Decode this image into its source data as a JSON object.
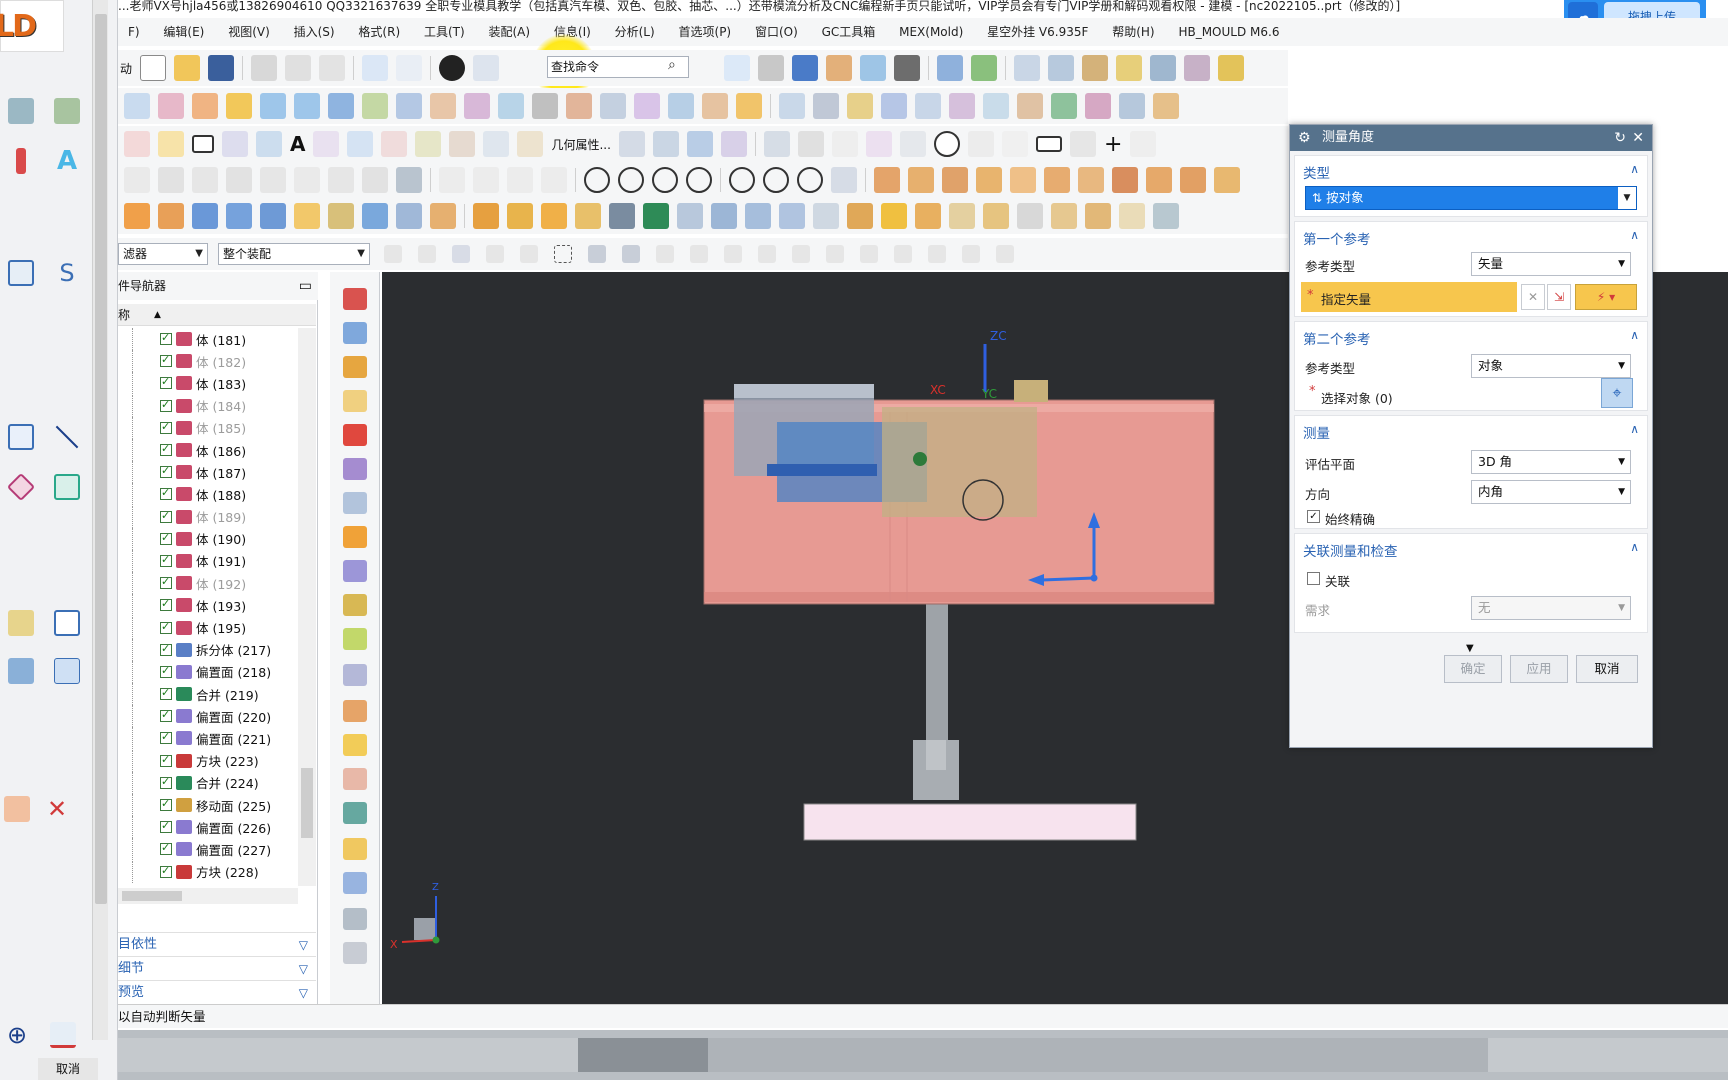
{
  "app": {
    "title_text": "...老师VX号hjla456或13826904610 QQ3321637639 全职专业模具教学（包括真汽车模、双色、包胶、抽芯、...）还带模流分析及CNC编程新手页只能试听，VIP学员会有专门VIP学册和解码观看权限 - 建模 - [nc2022105..prt（修改的）]",
    "logo_text": "LD",
    "cloud_upload_label": "拖拽上传"
  },
  "menu": {
    "items": [
      "F)",
      "编辑(E)",
      "视图(V)",
      "插入(S)",
      "格式(R)",
      "工具(T)",
      "装配(A)",
      "信息(I)",
      "分析(L)",
      "首选项(P)",
      "窗口(O)",
      "GC工具箱",
      "MEX(Mold)",
      "星空外挂 V6.935F",
      "帮助(H)",
      "HB_MOULD M6.6"
    ]
  },
  "toolbar": {
    "search_placeholder": "查找命令",
    "geometry_props_label": "几何属性...",
    "row1_left_label": "动"
  },
  "filter_row": {
    "type_filter": "滤器",
    "scope_filter": "整个装配"
  },
  "navigator": {
    "title": "件导航器",
    "column_header": "称",
    "rows": [
      {
        "label": "体 (181)",
        "dim": false,
        "icon": "body-icon"
      },
      {
        "label": "体 (182)",
        "dim": true,
        "icon": "body-icon"
      },
      {
        "label": "体 (183)",
        "dim": false,
        "icon": "body-icon"
      },
      {
        "label": "体 (184)",
        "dim": true,
        "icon": "body-icon"
      },
      {
        "label": "体 (185)",
        "dim": true,
        "icon": "body-icon"
      },
      {
        "label": "体 (186)",
        "dim": false,
        "icon": "body-icon"
      },
      {
        "label": "体 (187)",
        "dim": false,
        "icon": "body-icon"
      },
      {
        "label": "体 (188)",
        "dim": false,
        "icon": "body-icon"
      },
      {
        "label": "体 (189)",
        "dim": true,
        "icon": "body-icon"
      },
      {
        "label": "体 (190)",
        "dim": false,
        "icon": "body-icon"
      },
      {
        "label": "体 (191)",
        "dim": false,
        "icon": "body-icon"
      },
      {
        "label": "体 (192)",
        "dim": true,
        "icon": "body-icon"
      },
      {
        "label": "体 (193)",
        "dim": false,
        "icon": "body-icon"
      },
      {
        "label": "体 (195)",
        "dim": false,
        "icon": "body-icon"
      },
      {
        "label": "拆分体 (217)",
        "dim": false,
        "icon": "split-body-icon"
      },
      {
        "label": "偏置面 (218)",
        "dim": false,
        "icon": "offset-face-icon"
      },
      {
        "label": "合并 (219)",
        "dim": false,
        "icon": "unite-icon"
      },
      {
        "label": "偏置面 (220)",
        "dim": false,
        "icon": "offset-face-icon"
      },
      {
        "label": "偏置面 (221)",
        "dim": false,
        "icon": "offset-face-icon"
      },
      {
        "label": "方块 (223)",
        "dim": false,
        "icon": "block-icon"
      },
      {
        "label": "合并 (224)",
        "dim": false,
        "icon": "unite-icon"
      },
      {
        "label": "移动面 (225)",
        "dim": false,
        "icon": "move-face-icon"
      },
      {
        "label": "偏置面 (226)",
        "dim": false,
        "icon": "offset-face-icon"
      },
      {
        "label": "偏置面 (227)",
        "dim": false,
        "icon": "offset-face-icon"
      },
      {
        "label": "方块 (228)",
        "dim": false,
        "icon": "block-icon"
      }
    ],
    "sections": [
      "目依性",
      "细节",
      "预览"
    ]
  },
  "viewport": {
    "axis_labels": {
      "zc": "ZC",
      "xc": "XC",
      "yc": "YC",
      "x": "X",
      "z": "Z"
    }
  },
  "dialog": {
    "title": "测量角度",
    "type_group": {
      "title": "类型",
      "value": "按对象"
    },
    "first_ref": {
      "title": "第一个参考",
      "ref_type_label": "参考类型",
      "ref_type_value": "矢量",
      "specify_vector_label": "指定矢量"
    },
    "second_ref": {
      "title": "第二个参考",
      "ref_type_label": "参考类型",
      "ref_type_value": "对象",
      "select_object_label": "选择对象 (0)"
    },
    "measure": {
      "title": "测量",
      "eval_plane_label": "评估平面",
      "eval_plane_value": "3D 角",
      "direction_label": "方向",
      "direction_value": "内角",
      "always_precise_label": "始终精确",
      "always_precise_checked": true
    },
    "assoc": {
      "title": "关联测量和检查",
      "assoc_label": "关联",
      "assoc_checked": false,
      "requirement_label": "需求",
      "requirement_value": "无"
    },
    "buttons": {
      "ok": "确定",
      "apply": "应用",
      "cancel": "取消"
    }
  },
  "status": {
    "text": "以自动判断矢量",
    "left_cancel": "取消"
  }
}
